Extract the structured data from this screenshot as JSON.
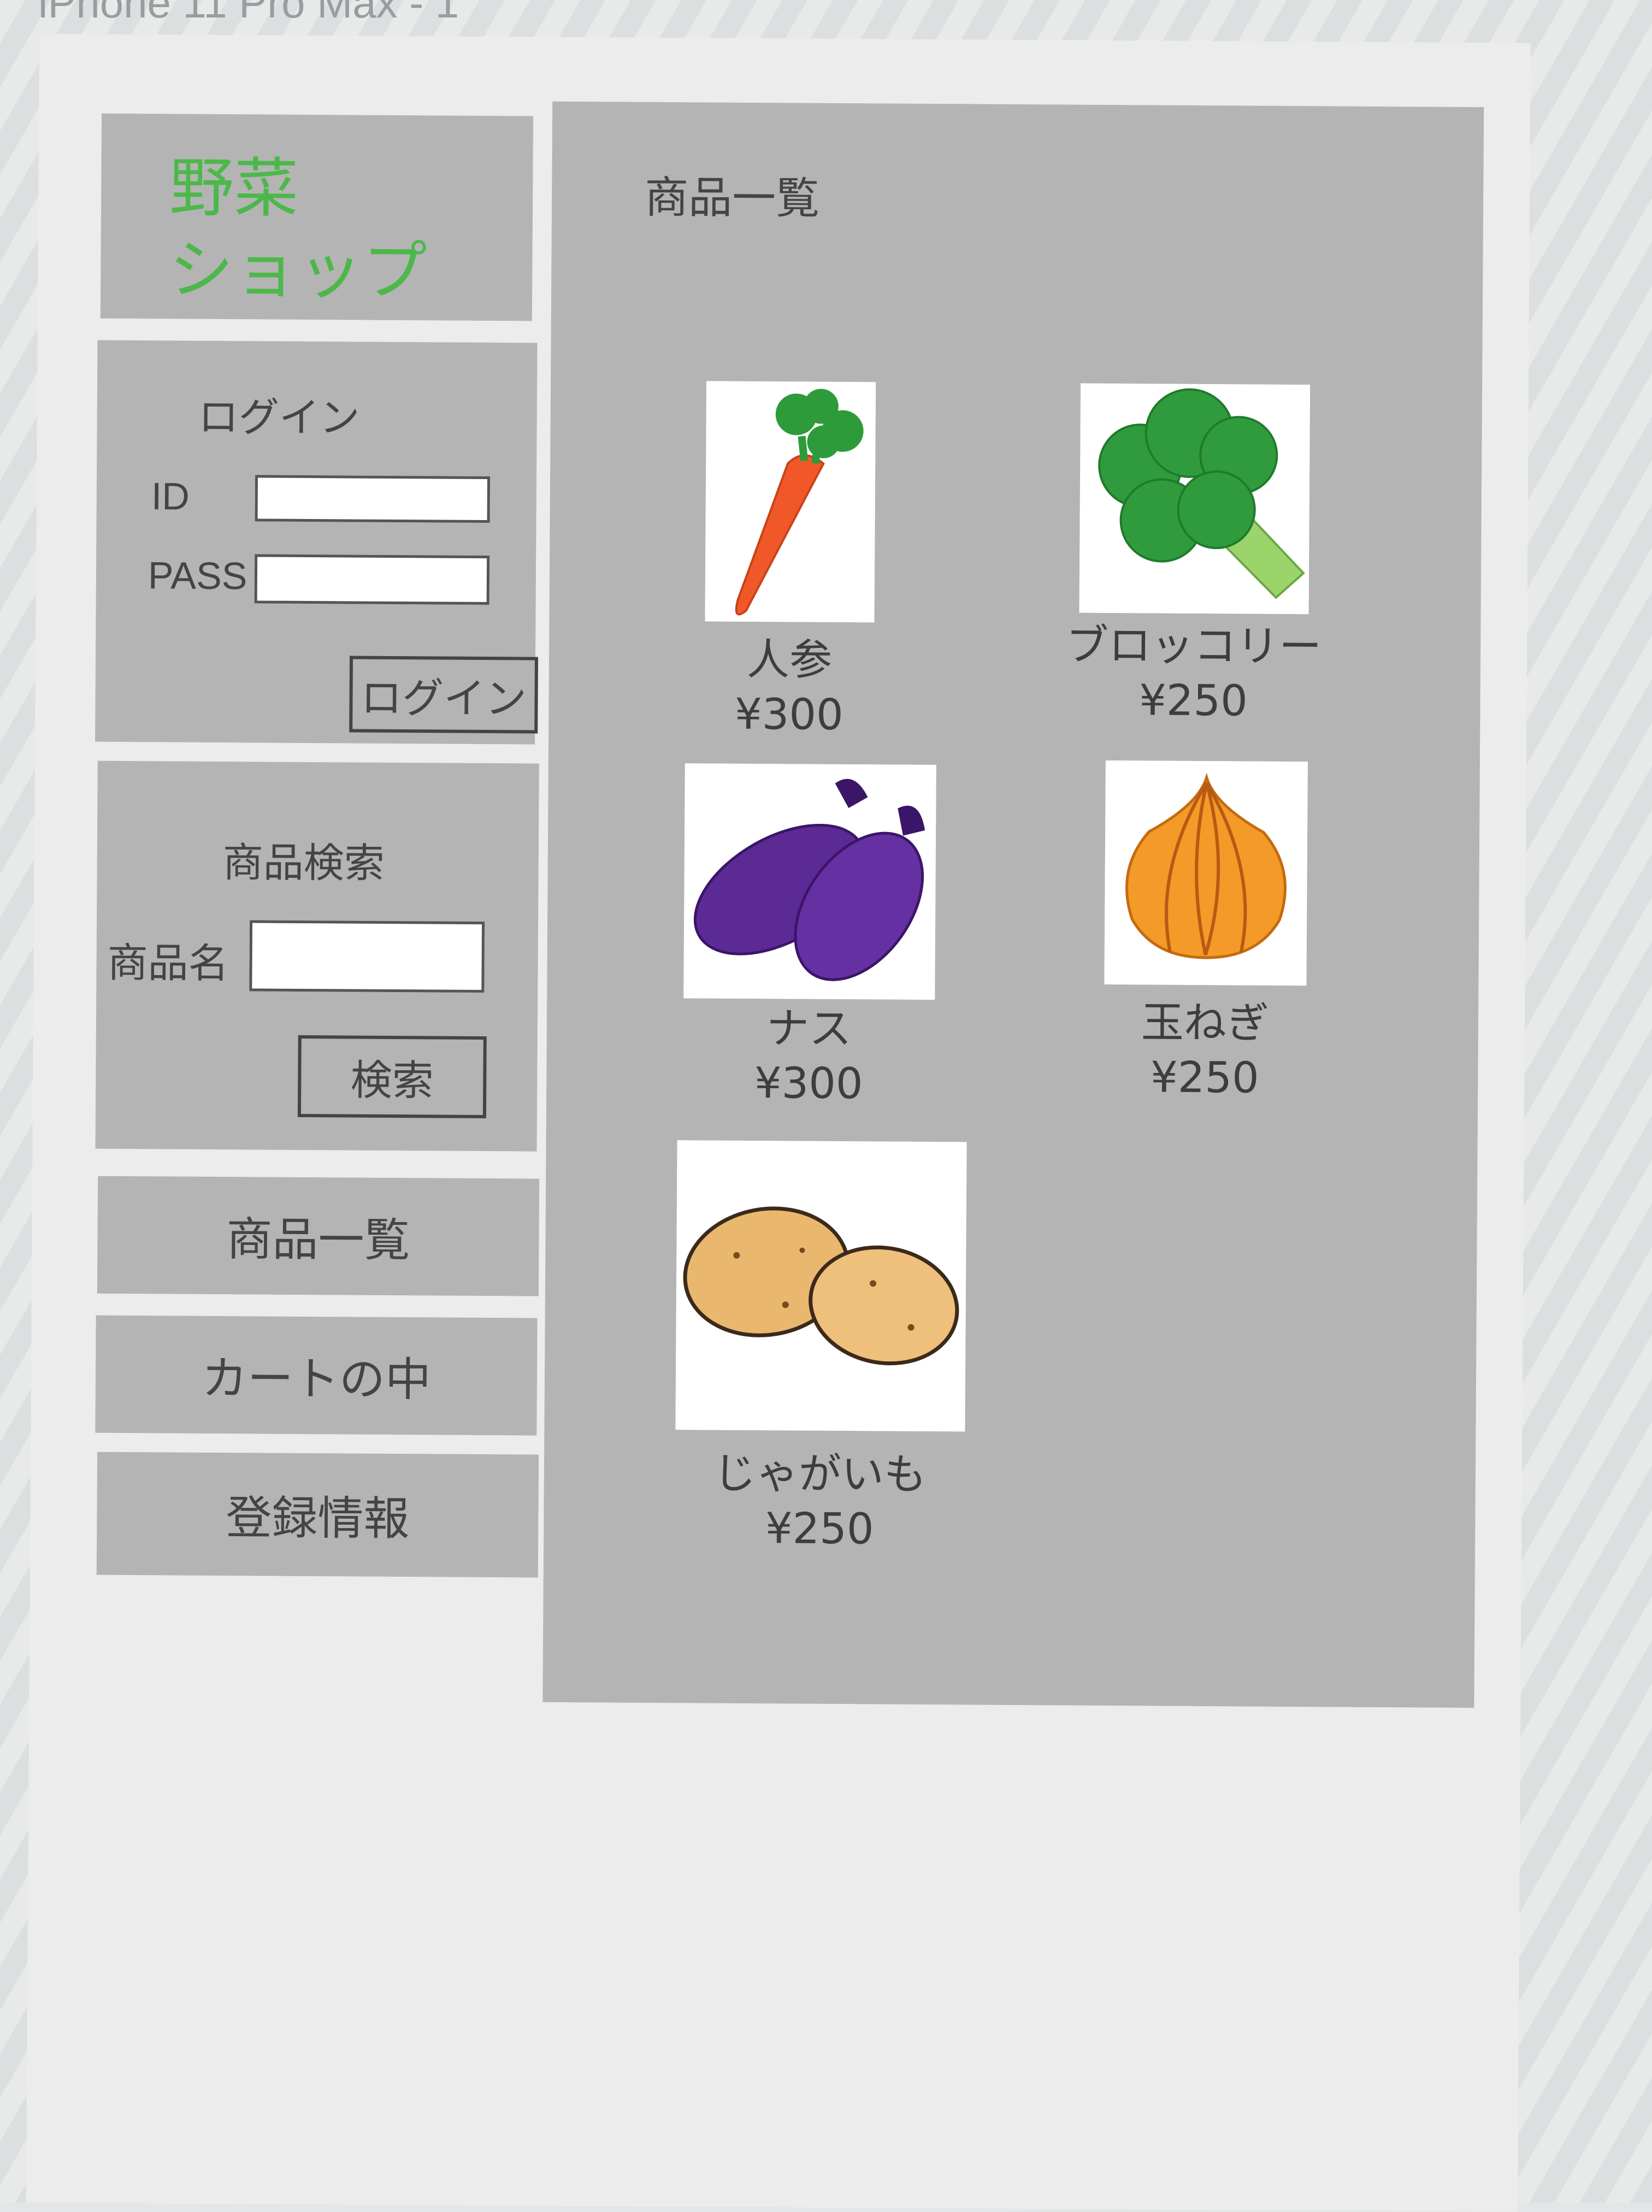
{
  "frame_title": "iPhone 11 Pro Max - 1",
  "sidebar": {
    "logo": {
      "line1": "野菜",
      "line2": "ショップ"
    },
    "login": {
      "title": "ログイン",
      "id_label": "ID",
      "pass_label": "PASS",
      "id_value": "",
      "pass_value": "",
      "button_label": "ログイン"
    },
    "search": {
      "title": "商品検索",
      "name_label": "商品名",
      "name_value": "",
      "button_label": "検索"
    },
    "nav": [
      {
        "label": "商品一覧"
      },
      {
        "label": "カートの中"
      },
      {
        "label": "登録情報"
      }
    ]
  },
  "main": {
    "title": "商品一覧",
    "products": [
      {
        "name": "人参",
        "price": "¥300",
        "icon": "carrot-icon"
      },
      {
        "name": "ブロッコリー",
        "price": "¥250",
        "icon": "broccoli-icon"
      },
      {
        "name": "ナス",
        "price": "¥300",
        "icon": "eggplant-icon"
      },
      {
        "name": "玉ねぎ",
        "price": "¥250",
        "icon": "onion-icon"
      },
      {
        "name": "じゃがいも",
        "price": "¥250",
        "icon": "potato-icon"
      }
    ]
  },
  "colors": {
    "panel": "#b4b4b4",
    "logo_text": "#4db84a",
    "artboard": "#ececec"
  }
}
